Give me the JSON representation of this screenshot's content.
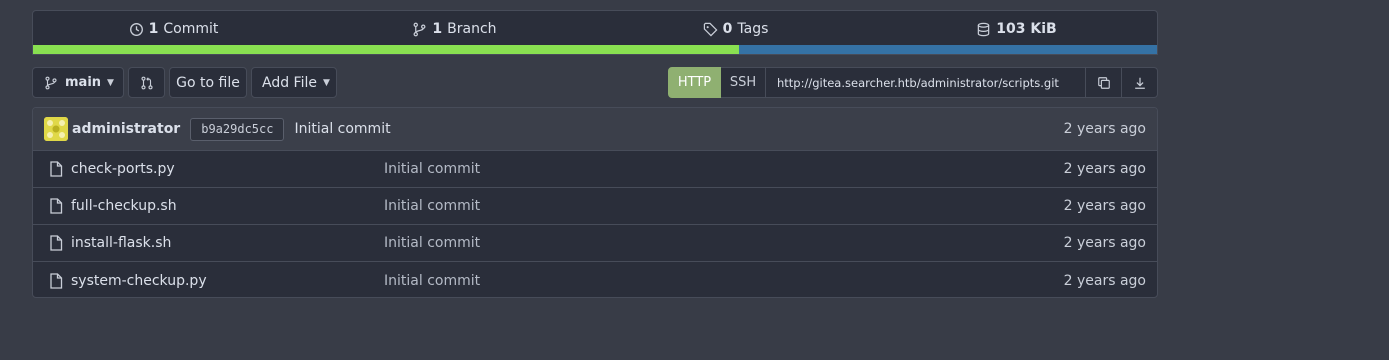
{
  "stats": {
    "commits": {
      "count": "1",
      "label": "Commit"
    },
    "branches": {
      "count": "1",
      "label": "Branch"
    },
    "tags": {
      "count": "0",
      "label": "Tags"
    },
    "size": {
      "value": "103 KiB"
    }
  },
  "language_bar": [
    {
      "color": "#89e051",
      "fraction": 0.628
    },
    {
      "color": "#3572a5",
      "fraction": 0.372
    }
  ],
  "toolbar": {
    "branch": "main",
    "go_to_file": "Go to file",
    "add_file": "Add File",
    "clone": {
      "http_label": "HTTP",
      "ssh_label": "SSH",
      "url": "http://gitea.searcher.htb/administrator/scripts.git"
    }
  },
  "latest_commit": {
    "author": "administrator",
    "sha": "b9a29dc5cc",
    "message": "Initial commit",
    "time": "2 years ago"
  },
  "files": [
    {
      "name": "check-ports.py",
      "message": "Initial commit",
      "time": "2 years ago"
    },
    {
      "name": "full-checkup.sh",
      "message": "Initial commit",
      "time": "2 years ago"
    },
    {
      "name": "install-flask.sh",
      "message": "Initial commit",
      "time": "2 years ago"
    },
    {
      "name": "system-checkup.py",
      "message": "Initial commit",
      "time": "2 years ago"
    }
  ],
  "colors": {
    "background": "#383c47",
    "panel": "#2a2e3a",
    "accent_green": "#8fb071"
  }
}
